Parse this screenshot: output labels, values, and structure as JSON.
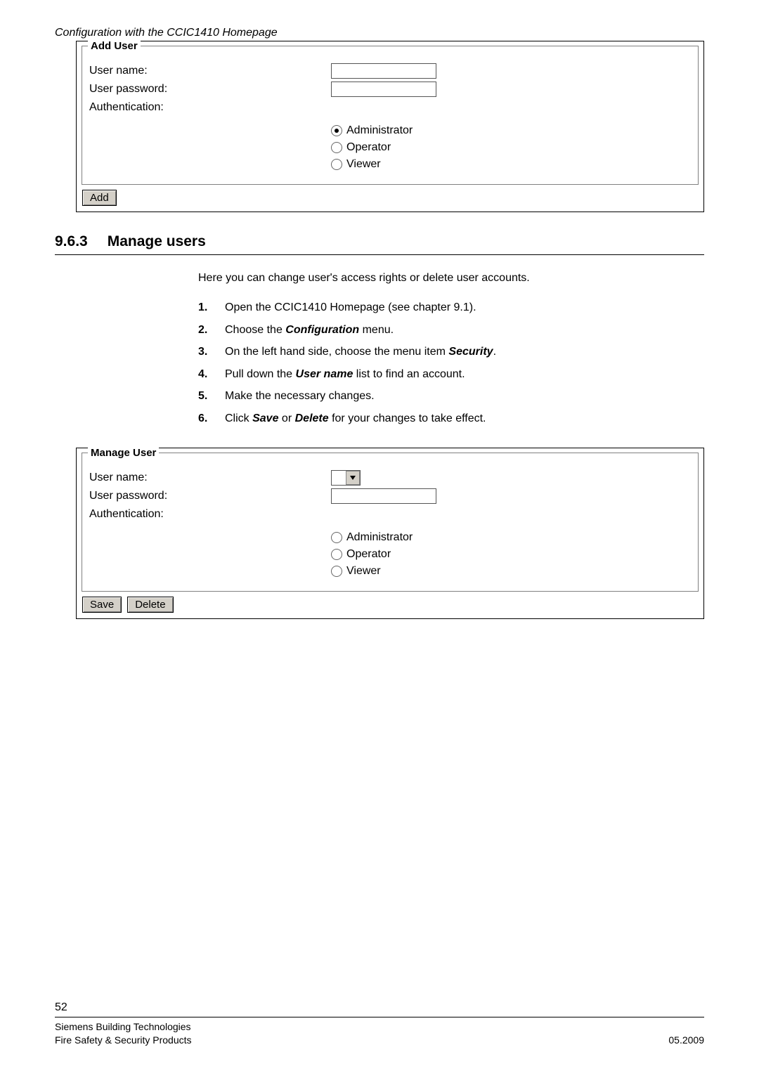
{
  "page_header": "Configuration with the CCIC1410 Homepage",
  "add_user_fieldset": {
    "legend": "Add User",
    "username_label": "User name:",
    "password_label": "User password:",
    "auth_label": "Authentication:",
    "options": {
      "admin": "Administrator",
      "operator": "Operator",
      "viewer": "Viewer"
    },
    "selected": "admin",
    "add_button": "Add"
  },
  "section": {
    "number": "9.6.3",
    "title": "Manage users"
  },
  "intro_paragraph": "Here you can change user's access rights or delete user accounts.",
  "steps": [
    {
      "n": "1.",
      "pre": "Open the CCIC1410 Homepage (see chapter 9.1)."
    },
    {
      "n": "2.",
      "pre": "Choose the ",
      "bi": "Configuration",
      "post": " menu."
    },
    {
      "n": "3.",
      "pre": "On the left hand side, choose the menu item ",
      "bi": "Security",
      "post": "."
    },
    {
      "n": "4.",
      "pre": "Pull down the ",
      "bi": "User name",
      "post": " list to find an account."
    },
    {
      "n": "5.",
      "pre": "Make the necessary changes."
    },
    {
      "n": "6.",
      "pre": "Click ",
      "bi": "Save",
      "mid": " or ",
      "bi2": "Delete",
      "post": " for your changes to take effect."
    }
  ],
  "manage_user_fieldset": {
    "legend": "Manage User",
    "username_label": "User name:",
    "password_label": "User password:",
    "auth_label": "Authentication:",
    "options": {
      "admin": "Administrator",
      "operator": "Operator",
      "viewer": "Viewer"
    },
    "selected": null,
    "save_button": "Save",
    "delete_button": "Delete"
  },
  "footer": {
    "page_number": "52",
    "line1_left": "Siemens Building Technologies",
    "line2_left": "Fire Safety & Security Products",
    "line2_right": "05.2009"
  }
}
